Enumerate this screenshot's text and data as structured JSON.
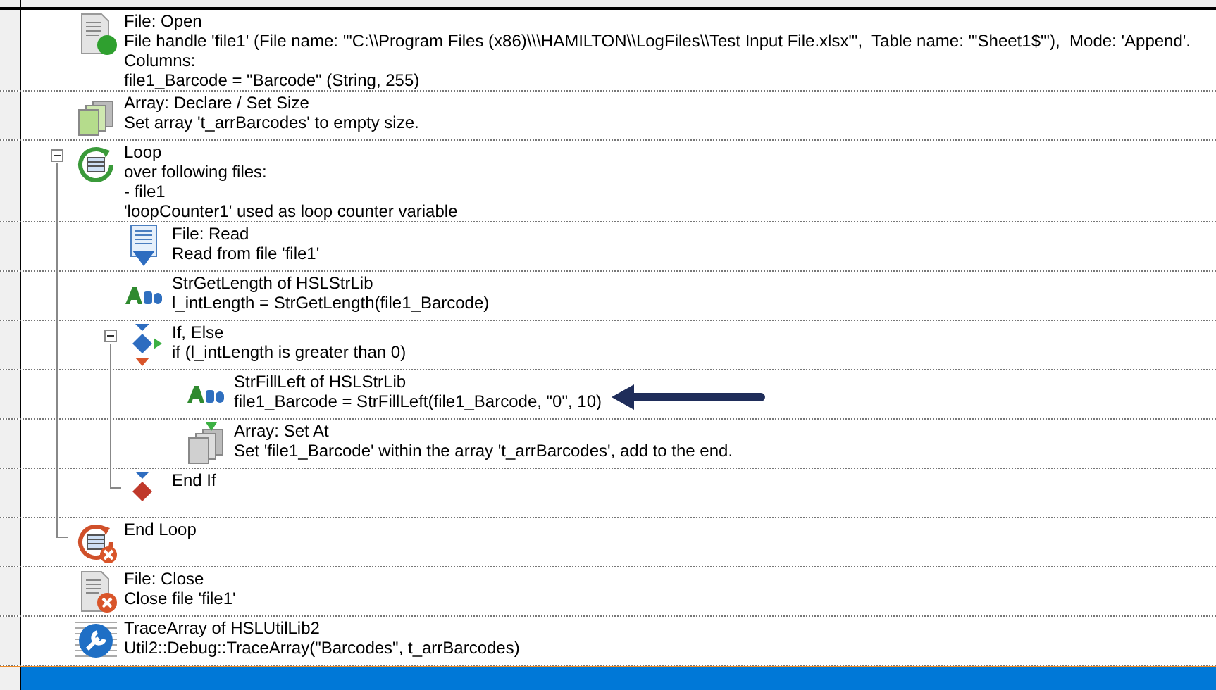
{
  "steps": [
    {
      "kind": "file_open",
      "title": "File: Open",
      "lines": [
        "File handle 'file1' (File name: '\"C:\\\\Program Files (x86)\\\\\\HAMILTON\\\\LogFiles\\\\Test Input File.xlsx\"',  Table name: '\"Sheet1$\"'),  Mode: 'Append'.",
        "Columns:",
        "file1_Barcode = \"Barcode\" (String, 255)"
      ],
      "selected": false
    },
    {
      "kind": "array_declare",
      "title": "Array: Declare / Set Size",
      "lines": [
        "Set array 't_arrBarcodes' to empty size."
      ],
      "selected": false
    },
    {
      "kind": "loop",
      "title": "Loop",
      "lines": [
        "over following files:",
        "- file1",
        "'loopCounter1' used as loop counter variable"
      ],
      "selected": false,
      "expanded": true,
      "children": [
        {
          "kind": "file_read",
          "title": "File: Read",
          "lines": [
            "Read from file 'file1'"
          ],
          "selected": false
        },
        {
          "kind": "string",
          "title": "StrGetLength of HSLStrLib",
          "lines": [
            "l_intLength = StrGetLength(file1_Barcode)"
          ],
          "selected": false
        },
        {
          "kind": "if_else",
          "title": "If, Else",
          "lines": [
            "if (l_intLength is greater than 0)"
          ],
          "selected": false,
          "expanded": true,
          "children": [
            {
              "kind": "string",
              "title": "StrFillLeft of HSLStrLib",
              "lines": [
                "file1_Barcode = StrFillLeft(file1_Barcode, \"0\", 10)"
              ],
              "selected": false,
              "pointer_arrow": true
            },
            {
              "kind": "array_set",
              "title": "Array: Set At",
              "lines": [
                "Set 'file1_Barcode' within the array 't_arrBarcodes', add to the end."
              ],
              "selected": false
            }
          ],
          "end": {
            "kind": "end_if",
            "title": "End If",
            "selected": false
          }
        }
      ],
      "end": {
        "kind": "end_loop",
        "title": "End Loop",
        "selected": false
      }
    },
    {
      "kind": "file_close",
      "title": "File: Close",
      "lines": [
        "Close file 'file1'"
      ],
      "selected": false
    },
    {
      "kind": "trace",
      "title": "TraceArray of HSLUtilLib2",
      "lines": [
        "Util2::Debug::TraceArray(\"Barcodes\", t_arrBarcodes)"
      ],
      "selected": false
    }
  ],
  "insertion_row": {
    "selected": true
  }
}
